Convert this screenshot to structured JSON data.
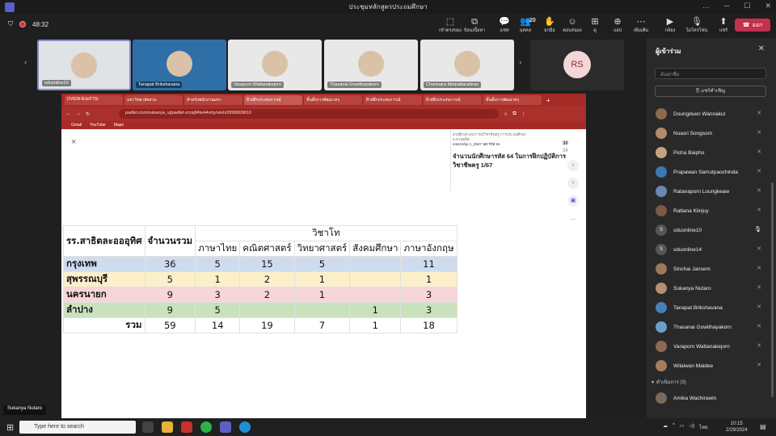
{
  "window": {
    "title": "ประชุมหลักสูตรประถมศึกษา"
  },
  "toolbar": {
    "timer": "48:32",
    "buttons": [
      {
        "label": "เข้าตรงของ",
        "icon": "camera-view-icon"
      },
      {
        "label": "ป้อนเนื้อหา",
        "icon": "share-content-icon"
      },
      {
        "label": "แชท",
        "icon": "chat-icon"
      },
      {
        "label": "บุคคล",
        "icon": "people-icon",
        "count": "20"
      },
      {
        "label": "ยกมือ",
        "icon": "raise-hand-icon"
      },
      {
        "label": "ตอบสนอง",
        "icon": "react-icon"
      },
      {
        "label": "ดู",
        "icon": "view-icon"
      },
      {
        "label": "แอป",
        "icon": "apps-icon"
      },
      {
        "label": "เพิ่มเติม",
        "icon": "more-icon"
      },
      {
        "label": "กล้อง",
        "icon": "camera-icon"
      },
      {
        "label": "ไมโครโฟน",
        "icon": "mic-icon"
      },
      {
        "label": "แชร์",
        "icon": "share-icon"
      }
    ],
    "leave_label": "ออก"
  },
  "gallery": [
    {
      "name": "sduonline10"
    },
    {
      "name": "Tanapat Brikshavana"
    },
    {
      "name": "Varaporn Wattanakejorn"
    },
    {
      "name": "Thasanai Gowithayakorn"
    },
    {
      "name": "Chanisara Metpattarahiran"
    },
    {
      "name": ""
    },
    {
      "name": "",
      "initials": "RS"
    }
  ],
  "browser": {
    "tabs": [
      "DVIEW-BJs/FTSt",
      "มหาวิทยาลัยสวน",
      "สำหรับพนักงานมหา",
      "ฝ้ายฝึกประสบการณ์",
      "ขั้นตั้งการพัฒนาครุ",
      "ฝ้ายฝึกประสบการณ์",
      "ฝ้ายฝึกประสบการณ์",
      "ขั้นตั้งการพัฒนาครุ"
    ],
    "address": "padlet.com/sukanya_vj/padlet-zcrsj84te44vrty/wish/2899809810",
    "bookmarks": [
      "Gmail",
      "YouTube",
      "Maps"
    ]
  },
  "padlet": {
    "close_symbol": "×",
    "side_small_1": "ฝ่ายฝึกประสบการณ์วิชาชีพครู การประถมศึกษา",
    "side_small_2": "อ.สวนดุสิต",
    "side_small_3": "internship 1_2567 นศ.รหัส 64",
    "side_title": "จำนวนนักศึกษารหัส 64 ในการฝึกปฏิบัติการวิชาชีพครู 1/67",
    "counter_top": "30",
    "counter_bottom": "34"
  },
  "table": {
    "col_school": "รร.สาธิตละอออุทิศ",
    "col_total": "จำนวนรวม",
    "col_major_group": "วิชาโท",
    "majors": [
      "ภาษาไทย",
      "คณิตศาสตร์",
      "วิทยาศาสตร์",
      "สังคมศึกษา",
      "ภาษาอังกฤษ"
    ],
    "rows": [
      {
        "name": "กรุงเทพ",
        "total": "36",
        "values": [
          "5",
          "15",
          "5",
          "",
          "11"
        ],
        "color": "#cfdcef"
      },
      {
        "name": "สุพรรณบุรี",
        "total": "5",
        "values": [
          "1",
          "2",
          "1",
          "",
          "1"
        ],
        "color": "#fcefc9"
      },
      {
        "name": "นครนายก",
        "total": "9",
        "values": [
          "3",
          "2",
          "1",
          "",
          "3"
        ],
        "color": "#f6d6d6"
      },
      {
        "name": "ลำปาง",
        "total": "9",
        "values": [
          "5",
          "",
          "",
          "1",
          "3"
        ],
        "color": "#c9e2bd"
      }
    ],
    "sum_label": "รวม",
    "sum_total": "59",
    "sum_values": [
      "14",
      "19",
      "7",
      "1",
      "18"
    ]
  },
  "panel": {
    "title": "ผู้เข้าร่วม",
    "search_placeholder": "ค้นหาชื่อ",
    "invite_label": "แชร์คำเชิญ",
    "section_label": "ดำเนินการ (3)",
    "participants": [
      "Doungduen Wannakul",
      "Nuasri Songsom",
      "Picha Baipho",
      "Prapawan Samutpaochinda",
      "Ratanaporn Loungkeaw",
      "Rattana Klinjuy",
      "sduonline10",
      "sduonline14",
      "Sinchai Jansem",
      "Sukanya Nutaro",
      "Tanapat Brikshavana",
      "Thasanai Gowithayakorn",
      "Varaporn Wattanakejorn",
      "Wilaiwan Maidee"
    ],
    "section_participants": [
      "Amika Wachirawin"
    ]
  },
  "caption": "Sukanya Nutaro",
  "taskbar": {
    "search_placeholder": "Type here to search",
    "lang": "ไทย",
    "time": "10:15",
    "date": "2/29/2024"
  }
}
